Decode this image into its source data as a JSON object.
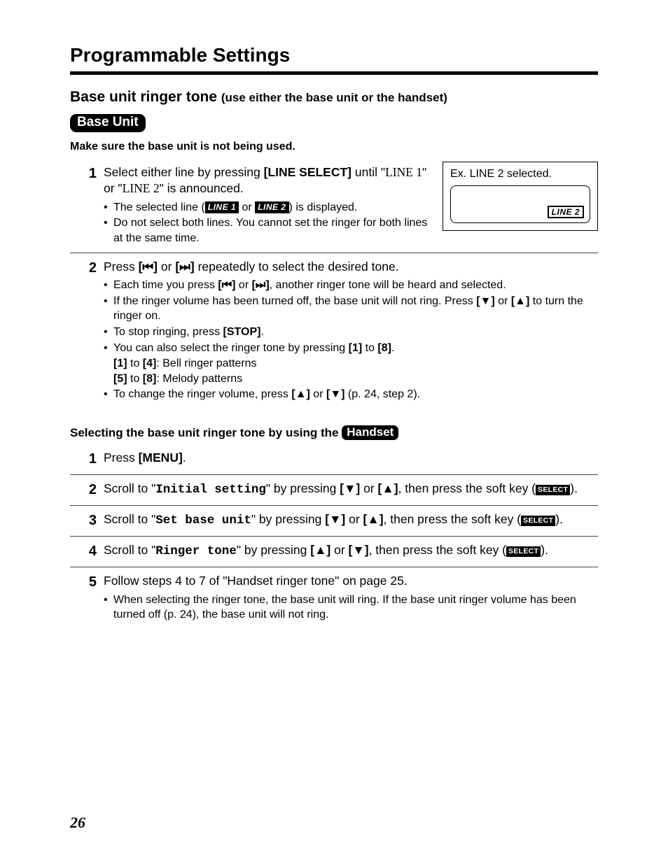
{
  "sectionTitle": "Programmable Settings",
  "subHeading": "Base unit ringer tone ",
  "subHeadingNote": "(use either the base unit or the handset)",
  "baseUnitLabel": "Base Unit",
  "warning": "Make sure the base unit is not being used.",
  "example": {
    "caption": "Ex. LINE 2 selected.",
    "lcdChip": "LINE 2"
  },
  "baseSteps": [
    {
      "num": "1",
      "parts": [
        {
          "t": "text",
          "v": "Select either line by pressing "
        },
        {
          "t": "bold",
          "v": "[LINE SELECT]"
        },
        {
          "t": "text",
          "v": " until \""
        },
        {
          "t": "lcdtext",
          "v": "LINE 1"
        },
        {
          "t": "text",
          "v": "\" or \""
        },
        {
          "t": "lcdtext",
          "v": "LINE 2"
        },
        {
          "t": "text",
          "v": "\" is announced."
        }
      ],
      "bullets": [
        [
          {
            "t": "text",
            "v": "The selected line ("
          },
          {
            "t": "chip",
            "v": "LINE 1"
          },
          {
            "t": "text",
            "v": " or "
          },
          {
            "t": "chip",
            "v": "LINE 2"
          },
          {
            "t": "text",
            "v": ") is displayed."
          }
        ],
        [
          {
            "t": "text",
            "v": "Do not select both lines. You cannot set the ringer for both lines at the same time."
          }
        ]
      ],
      "showExample": true
    },
    {
      "num": "2",
      "parts": [
        {
          "t": "text",
          "v": "Press "
        },
        {
          "t": "bold",
          "v": "[⏮]"
        },
        {
          "t": "text",
          "v": " or "
        },
        {
          "t": "bold",
          "v": "[⏭]"
        },
        {
          "t": "text",
          "v": " repeatedly to select the desired tone."
        }
      ],
      "bullets": [
        [
          {
            "t": "text",
            "v": "Each time you press "
          },
          {
            "t": "bold",
            "v": "[⏮]"
          },
          {
            "t": "text",
            "v": " or "
          },
          {
            "t": "bold",
            "v": "[⏭]"
          },
          {
            "t": "text",
            "v": ", another ringer tone will be heard and selected."
          }
        ],
        [
          {
            "t": "text",
            "v": "If the ringer volume has been turned off, the base unit will not ring. Press "
          },
          {
            "t": "bold",
            "v": "[▼]"
          },
          {
            "t": "text",
            "v": " or "
          },
          {
            "t": "bold",
            "v": "[▲]"
          },
          {
            "t": "text",
            "v": " to turn the ringer on."
          }
        ],
        [
          {
            "t": "text",
            "v": "To stop ringing, press "
          },
          {
            "t": "bold",
            "v": "[STOP]"
          },
          {
            "t": "text",
            "v": "."
          }
        ],
        [
          {
            "t": "text",
            "v": "You can also select the ringer tone by pressing "
          },
          {
            "t": "bold",
            "v": "[1]"
          },
          {
            "t": "text",
            "v": " to "
          },
          {
            "t": "bold",
            "v": "[8]"
          },
          {
            "t": "text",
            "v": "."
          }
        ],
        [
          {
            "t": "text",
            "v": "To change the ringer volume, press "
          },
          {
            "t": "bold",
            "v": "[▲]"
          },
          {
            "t": "text",
            "v": " or "
          },
          {
            "t": "bold",
            "v": "[▼]"
          },
          {
            "t": "text",
            "v": " (p. 24, step 2)."
          }
        ]
      ],
      "sublines": [
        [
          {
            "t": "bold",
            "v": "[1]"
          },
          {
            "t": "text",
            "v": " to "
          },
          {
            "t": "bold",
            "v": "[4]"
          },
          {
            "t": "text",
            "v": ": Bell ringer patterns"
          }
        ],
        [
          {
            "t": "bold",
            "v": "[5]"
          },
          {
            "t": "text",
            "v": " to "
          },
          {
            "t": "bold",
            "v": "[8]"
          },
          {
            "t": "text",
            "v": ": Melody patterns"
          }
        ]
      ],
      "sublinesAfterBullet": 3
    }
  ],
  "handsetHeading": "Selecting the base unit ringer tone by using the ",
  "handsetLabel": "Handset",
  "handsetSteps": [
    {
      "num": "1",
      "parts": [
        {
          "t": "text",
          "v": "Press "
        },
        {
          "t": "bold",
          "v": "[MENU]"
        },
        {
          "t": "text",
          "v": "."
        }
      ]
    },
    {
      "num": "2",
      "parts": [
        {
          "t": "text",
          "v": "Scroll to \""
        },
        {
          "t": "mono",
          "v": "Initial setting"
        },
        {
          "t": "text",
          "v": "\" by pressing "
        },
        {
          "t": "bold",
          "v": "[▼]"
        },
        {
          "t": "text",
          "v": " or "
        },
        {
          "t": "bold",
          "v": "[▲]"
        },
        {
          "t": "text",
          "v": ", then press the soft key ("
        },
        {
          "t": "select",
          "v": "SELECT"
        },
        {
          "t": "text",
          "v": ")."
        }
      ]
    },
    {
      "num": "3",
      "parts": [
        {
          "t": "text",
          "v": "Scroll to \""
        },
        {
          "t": "mono",
          "v": "Set base unit"
        },
        {
          "t": "text",
          "v": "\" by pressing "
        },
        {
          "t": "bold",
          "v": "[▼]"
        },
        {
          "t": "text",
          "v": " or "
        },
        {
          "t": "bold",
          "v": "[▲]"
        },
        {
          "t": "text",
          "v": ", then press the soft key ("
        },
        {
          "t": "select",
          "v": "SELECT"
        },
        {
          "t": "text",
          "v": ")."
        }
      ]
    },
    {
      "num": "4",
      "parts": [
        {
          "t": "text",
          "v": "Scroll to \""
        },
        {
          "t": "mono",
          "v": "Ringer tone"
        },
        {
          "t": "text",
          "v": "\" by pressing "
        },
        {
          "t": "bold",
          "v": "[▲]"
        },
        {
          "t": "text",
          "v": " or "
        },
        {
          "t": "bold",
          "v": "[▼]"
        },
        {
          "t": "text",
          "v": ", then press the soft key ("
        },
        {
          "t": "select",
          "v": "SELECT"
        },
        {
          "t": "text",
          "v": ")."
        }
      ]
    },
    {
      "num": "5",
      "parts": [
        {
          "t": "text",
          "v": "Follow steps 4 to 7 of \"Handset ringer tone\" on page 25."
        }
      ],
      "bullets": [
        [
          {
            "t": "text",
            "v": "When selecting the ringer tone, the base unit will ring. If the base unit ringer volume has been turned off (p. 24), the base unit will not ring."
          }
        ]
      ]
    }
  ],
  "pageNumber": "26"
}
